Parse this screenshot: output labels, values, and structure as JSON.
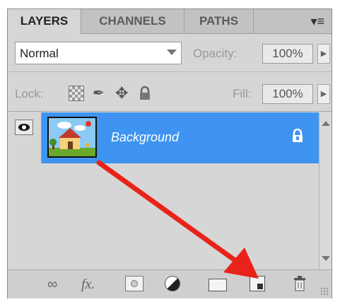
{
  "tabs": [
    {
      "label": "LAYERS",
      "active": true
    },
    {
      "label": "CHANNELS",
      "active": false
    },
    {
      "label": "PATHS",
      "active": false
    }
  ],
  "panel_menu_icon": "panel-menu-icon",
  "blend_mode": {
    "value": "Normal"
  },
  "opacity": {
    "label": "Opacity:",
    "value": "100%"
  },
  "lock": {
    "label": "Lock:",
    "icons": [
      "lock-transparent-pixels-icon",
      "lock-image-pixels-icon",
      "lock-position-icon",
      "lock-all-icon"
    ]
  },
  "fill": {
    "label": "Fill:",
    "value": "100%"
  },
  "layers": [
    {
      "name": "Background",
      "visible": true,
      "locked": true,
      "selected": true
    }
  ],
  "colors": {
    "selection": "#3e94f0",
    "panel": "#d6d6d6",
    "arrow": "#e8231a"
  },
  "toolbar_icons": [
    "link-layers-icon",
    "layer-style-icon",
    "add-mask-icon",
    "adjustment-layer-icon",
    "new-group-icon",
    "new-layer-icon",
    "delete-layer-icon"
  ]
}
